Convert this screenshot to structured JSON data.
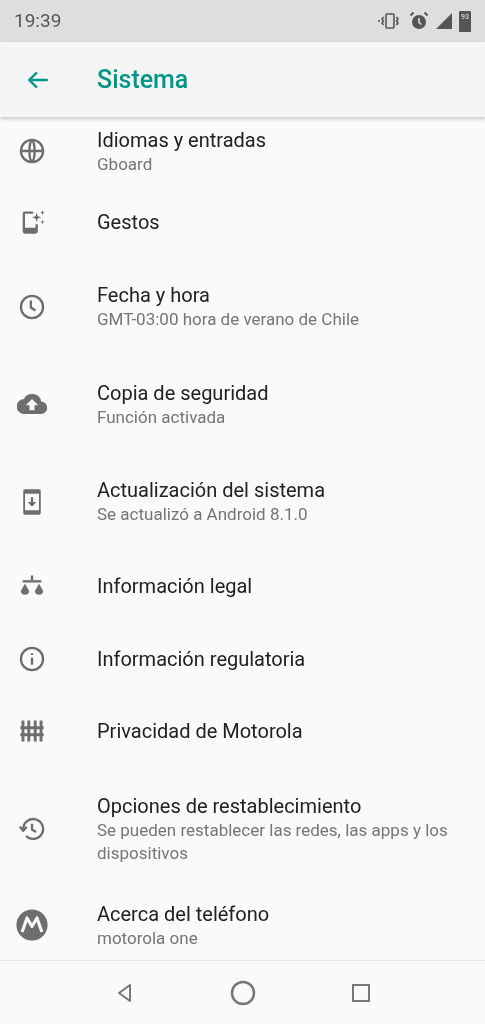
{
  "status_bar": {
    "time": "19:39",
    "battery": "93"
  },
  "app_bar": {
    "title": "Sistema"
  },
  "items": [
    {
      "title": "Idiomas y entradas",
      "subtitle": "Gboard"
    },
    {
      "title": "Gestos"
    },
    {
      "title": "Fecha y hora",
      "subtitle": "GMT-03:00 hora de verano de Chile"
    },
    {
      "title": "Copia de seguridad",
      "subtitle": "Función activada"
    },
    {
      "title": "Actualización del sistema",
      "subtitle": "Se actualizó a Android 8.1.0"
    },
    {
      "title": "Información legal"
    },
    {
      "title": "Información regulatoria"
    },
    {
      "title": "Privacidad de Motorola"
    },
    {
      "title": "Opciones de restablecimiento",
      "subtitle": "Se pueden restablecer las redes, las apps y los dispositivos"
    },
    {
      "title": "Acerca del teléfono",
      "subtitle": "motorola one"
    }
  ]
}
